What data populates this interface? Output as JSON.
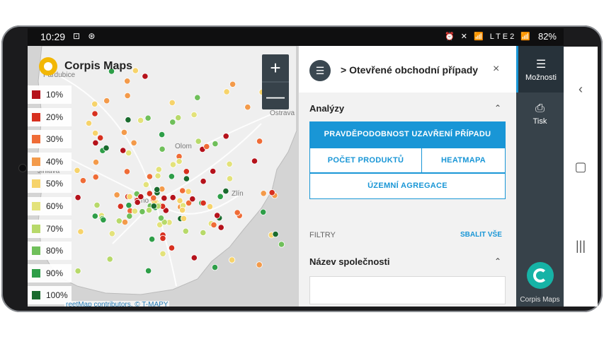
{
  "status_bar": {
    "time": "10:29",
    "left_icons": "⊡ ⊛",
    "right_icons": "⏰ ✕ 📶 LTE2 📶",
    "battery": "82%"
  },
  "map": {
    "brand": "Corpis Maps",
    "zoom_in": "+",
    "zoom_out": "—",
    "attribution": "reetMap contributors, © T-MAPY",
    "city_labels": [
      "Pardubice",
      "Ostrava",
      "Olom",
      "Brno",
      "Zlín",
      "Jihlava"
    ],
    "legend": [
      {
        "label": "10%",
        "color": "#b5121b"
      },
      {
        "label": "20%",
        "color": "#d7301f"
      },
      {
        "label": "30%",
        "color": "#ef6c37"
      },
      {
        "label": "40%",
        "color": "#f39a4a"
      },
      {
        "label": "50%",
        "color": "#f6d36b"
      },
      {
        "label": "60%",
        "color": "#e3e27a"
      },
      {
        "label": "70%",
        "color": "#b7d96a"
      },
      {
        "label": "80%",
        "color": "#6fbf5a"
      },
      {
        "label": "90%",
        "color": "#2e9e48"
      },
      {
        "label": "100%",
        "color": "#1a6b2e"
      }
    ]
  },
  "panel": {
    "title": "> Otevřené obchodní případy",
    "close": "×",
    "analyzy": "Analýzy",
    "buttons": {
      "probability": "PRAVDĚPODOBNOST UZAVŘENÍ PŘÍPADU",
      "products": "POČET PRODUKTŮ",
      "heatmap": "HEATMAPA",
      "territorial": "ÚZEMNÍ AGREGACE"
    },
    "filtry": "FILTRY",
    "collapse_all": "SBALIT VŠE",
    "company_name": "Název společnosti"
  },
  "sidebar": {
    "options": "Možnosti",
    "print": "Tisk",
    "brand": "Corpis Maps"
  },
  "colors": {
    "accent": "#1996d6",
    "sidebar": "#37424a"
  }
}
